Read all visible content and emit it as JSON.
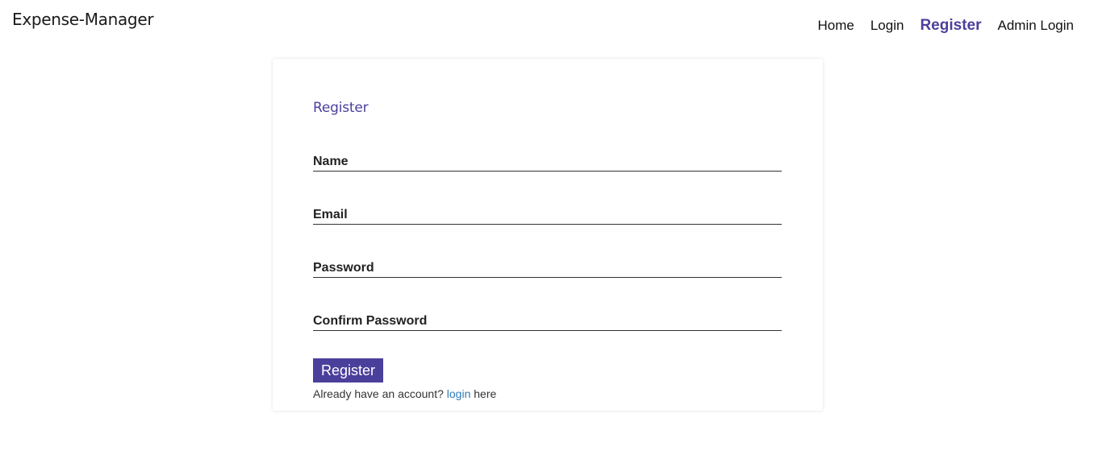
{
  "header": {
    "brand": "Expense-Manager",
    "nav": [
      {
        "label": "Home",
        "active": false
      },
      {
        "label": "Login",
        "active": false
      },
      {
        "label": "Register",
        "active": true
      },
      {
        "label": "Admin Login",
        "active": false
      }
    ]
  },
  "form": {
    "title": "Register",
    "fields": [
      {
        "label": "Name",
        "value": ""
      },
      {
        "label": "Email",
        "value": ""
      },
      {
        "label": "Password",
        "value": ""
      },
      {
        "label": "Confirm Password",
        "value": ""
      }
    ],
    "submit_label": "Register",
    "footer": {
      "prefix": "Already have an account?",
      "link": "login",
      "suffix": "here"
    }
  },
  "colors": {
    "accent": "#4b3f9c",
    "link": "#2f7ab8"
  }
}
